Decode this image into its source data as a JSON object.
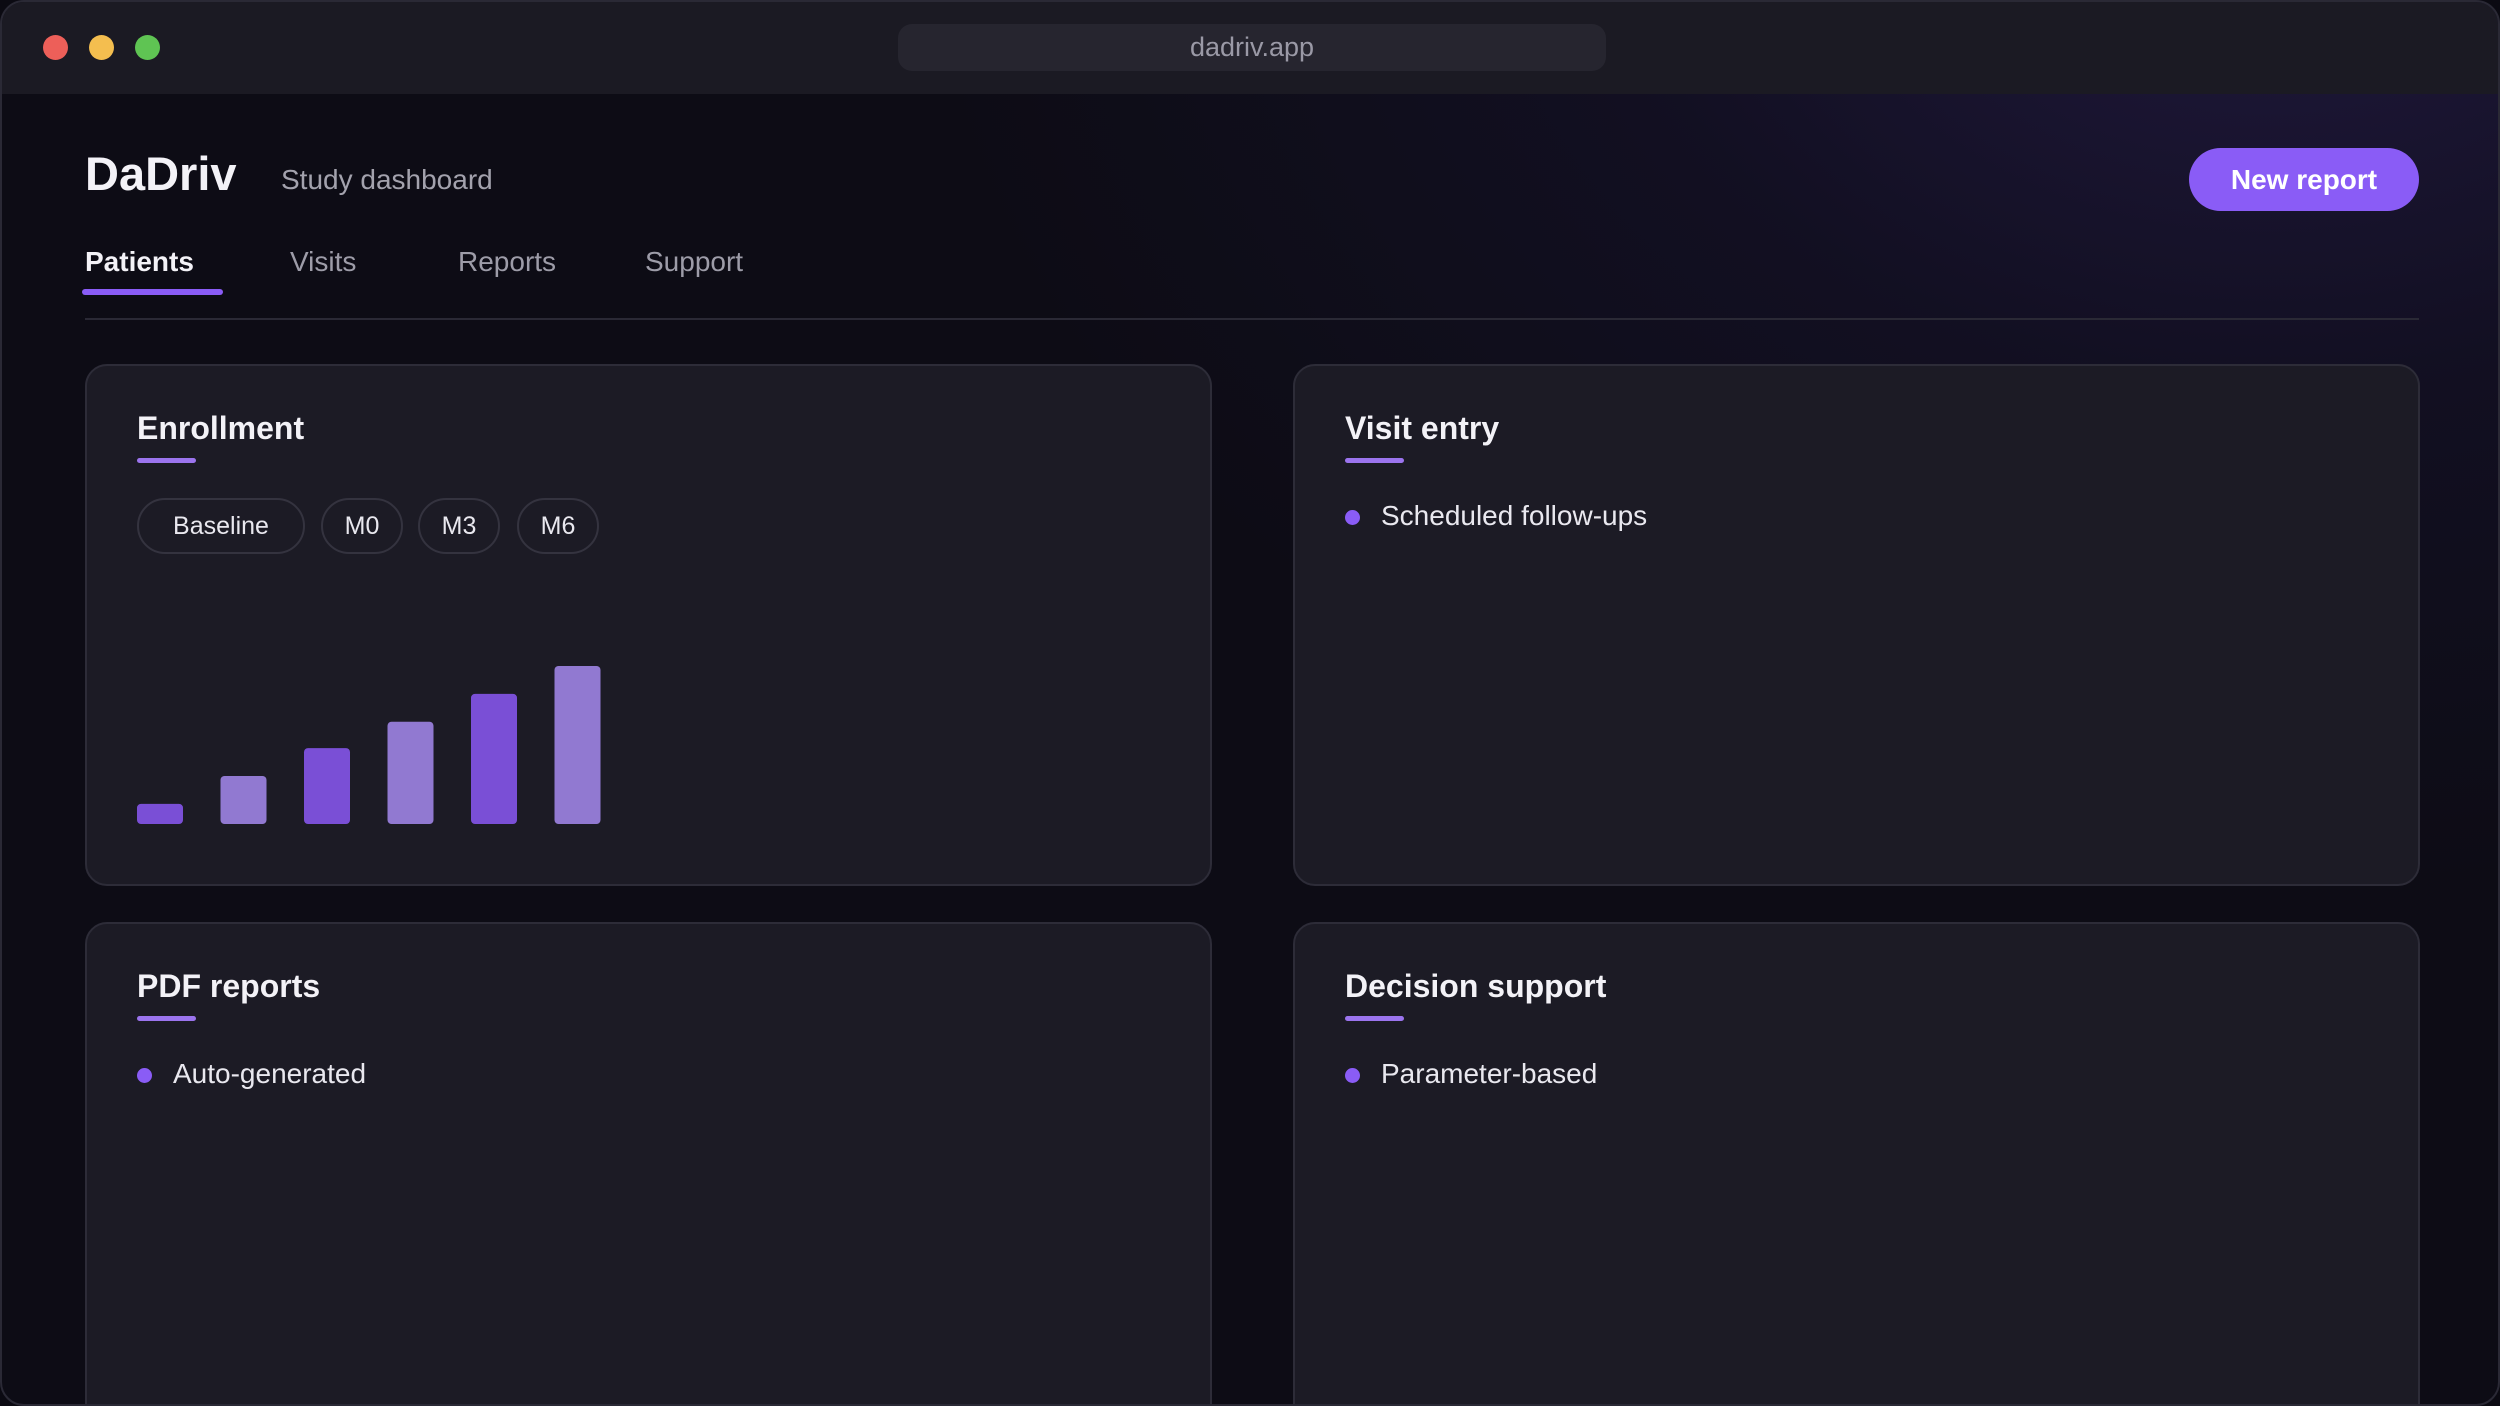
{
  "window": {
    "url": "dadriv.app"
  },
  "header": {
    "brand": "DaDriv",
    "subtitle": "Study dashboard",
    "new_report_label": "New report"
  },
  "tabs": [
    {
      "label": "Patients",
      "active": true
    },
    {
      "label": "Visits",
      "active": false
    },
    {
      "label": "Reports",
      "active": false
    },
    {
      "label": "Support",
      "active": false
    }
  ],
  "cards": {
    "enrollment": {
      "title": "Enrollment",
      "chips": [
        "Baseline",
        "M0",
        "M3",
        "M6"
      ]
    },
    "visit_entry": {
      "title": "Visit entry",
      "items": [
        "Scheduled follow-ups"
      ]
    },
    "pdf_reports": {
      "title": "PDF reports",
      "items": [
        "Auto-generated"
      ]
    },
    "decision_support": {
      "title": "Decision support",
      "items": [
        "Parameter-based"
      ]
    }
  },
  "chart_data": {
    "type": "bar",
    "values": [
      13,
      31,
      49,
      66,
      84,
      102
    ],
    "colors": [
      "#7a4fd6",
      "#9179d1",
      "#7a4fd6",
      "#9179d1",
      "#7a4fd6",
      "#9179d1"
    ]
  },
  "colors": {
    "accent": "#8a5cf6",
    "background": "#0d0c15",
    "card": "#1c1b25"
  }
}
